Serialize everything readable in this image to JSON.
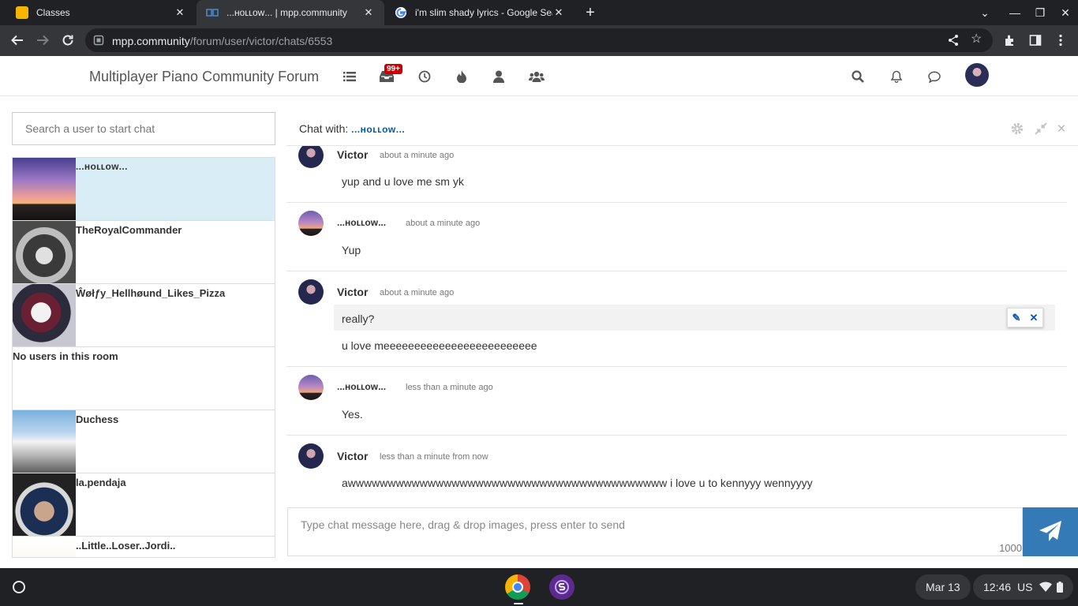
{
  "browser": {
    "tabs": [
      {
        "title": "Classes"
      },
      {
        "title": "...ʜᴏʟʟᴏᴡ... | mpp.community"
      },
      {
        "title": "i'm slim shady lyrics - Google Search"
      }
    ],
    "url_host": "mpp.community",
    "url_path": "/forum/user/victor/chats/6553"
  },
  "forum": {
    "brand": "Multiplayer Piano Community Forum",
    "unread_badge": "99+"
  },
  "sidebar": {
    "search_placeholder": "Search a user to start chat",
    "users": [
      {
        "name": "...ʜᴏʟʟᴏᴡ..."
      },
      {
        "name": "TheRoyalCommander"
      },
      {
        "name": "Ŵøłƒy_Hellhøund_Likes_Pizza"
      },
      {
        "name": "No users in this room"
      },
      {
        "name": "Duchess"
      },
      {
        "name": "la.pendaja"
      },
      {
        "name": "..Little..Loser..Jordi.."
      }
    ]
  },
  "chat": {
    "with_label": "Chat with:",
    "with_user": "...ʜᴏʟʟᴏᴡ...",
    "messages": [
      {
        "author": "Victor",
        "time": "about a minute ago",
        "lines": [
          "yup and u love me sm yk"
        ]
      },
      {
        "author": "...ʜᴏʟʟᴏᴡ...",
        "time": "about a minute ago",
        "lines": [
          "Yup"
        ]
      },
      {
        "author": "Victor",
        "time": "about a minute ago",
        "lines": [
          "really?",
          "u love meeeeeeeeeeeeeeeeeeeeeeeee"
        ]
      },
      {
        "author": "...ʜᴏʟʟᴏᴡ...",
        "time": "less than a minute ago",
        "lines": [
          "Yes."
        ]
      },
      {
        "author": "Victor",
        "time": "less than a minute from now",
        "lines": [
          "awwwwwwwwwwwwwwwwwwwwwwwwwwwwwwwwwwwwwwww i love u to kennyyy wennyyyy"
        ]
      }
    ],
    "composer_placeholder": "Type chat message here, drag & drop images, press enter to send",
    "char_count": "1000"
  },
  "shelf": {
    "date": "Mar 13",
    "time": "12:46",
    "locale": "US"
  },
  "colors": {
    "accent": "#337ab7",
    "link": "#0059b2",
    "selected_row": "#d9edf7",
    "badge": "#cc0000"
  }
}
